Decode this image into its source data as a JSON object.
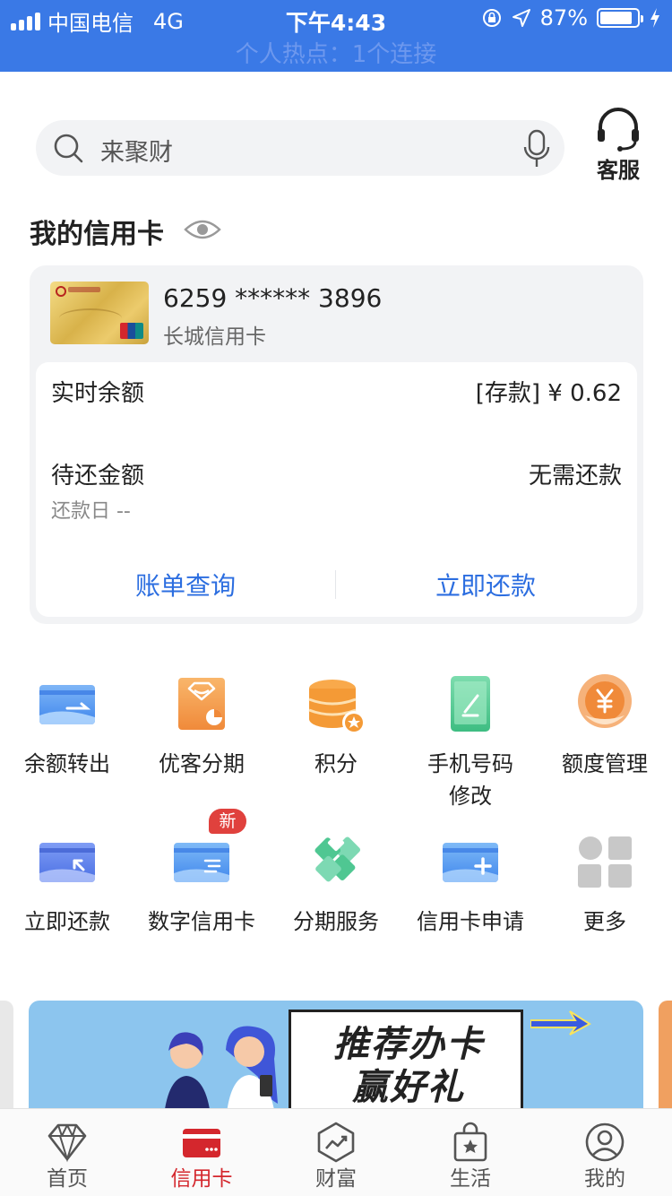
{
  "status_bar": {
    "carrier": "中国电信",
    "network": "4G",
    "time": "下午4:43",
    "battery": "87%",
    "battery_level": 0.87,
    "hotspot": "个人热点：1个连接"
  },
  "search": {
    "placeholder": "来聚财"
  },
  "customer_service": {
    "label": "客服"
  },
  "credit_card_section": {
    "title": "我的信用卡",
    "card_number": "6259 ****** 3896",
    "card_name": "长城信用卡",
    "balance_label": "实时余额",
    "balance_value": "[存款] ¥ 0.62",
    "due_label": "待还金额",
    "due_value": "无需还款",
    "due_date_label": "还款日 --",
    "actions": {
      "bill_query": "账单查询",
      "repay_now": "立即还款"
    }
  },
  "services": [
    {
      "label": "余额转出",
      "icon": "card-transfer-icon"
    },
    {
      "label": "优客分期",
      "icon": "installment-bag-icon"
    },
    {
      "label": "积分",
      "icon": "points-coins-icon"
    },
    {
      "label": "手机号码修改",
      "label_line1": "手机号码",
      "label_line2": "修改",
      "icon": "phone-edit-icon"
    },
    {
      "label": "额度管理",
      "icon": "credit-limit-yuan-icon"
    },
    {
      "label": "立即还款",
      "icon": "card-repay-icon"
    },
    {
      "label": "数字信用卡",
      "icon": "digital-card-icon",
      "badge": "新"
    },
    {
      "label": "分期服务",
      "icon": "installment-service-icon"
    },
    {
      "label": "信用卡申请",
      "icon": "card-apply-icon"
    },
    {
      "label": "更多",
      "icon": "more-grid-icon"
    }
  ],
  "banner": {
    "line1": "推荐办卡",
    "line2": "赢好礼"
  },
  "tabbar": {
    "items": [
      {
        "label": "首页",
        "icon": "diamond-icon",
        "active": false
      },
      {
        "label": "信用卡",
        "icon": "credit-card-icon",
        "active": true
      },
      {
        "label": "财富",
        "icon": "wealth-chart-icon",
        "active": false
      },
      {
        "label": "生活",
        "icon": "shopping-bag-icon",
        "active": false
      },
      {
        "label": "我的",
        "icon": "user-profile-icon",
        "active": false
      }
    ]
  },
  "colors": {
    "status_bar": "#3a79e6",
    "link_blue": "#2c6ee0",
    "active_tab": "#d4272d",
    "panel_bg": "#f2f3f5"
  }
}
